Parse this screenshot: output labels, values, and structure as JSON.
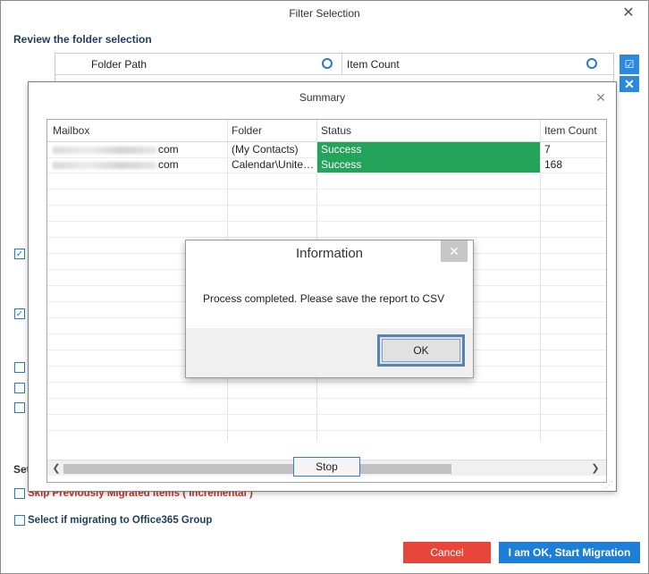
{
  "main_window": {
    "title": "Filter Selection",
    "close_glyph": "✕",
    "review_label": "Review the folder selection",
    "folder_grid": {
      "col_folder_path": "Folder Path",
      "col_item_count": "Item Count"
    },
    "side_buttons": [
      "check-icon",
      "close-icon"
    ],
    "settings_label": "Set",
    "skip_label": "Skip Previously Migrated Items ( Incremental )",
    "o365_label": "Select if migrating to Office365 Group",
    "cancel_label": "Cancel",
    "start_label": "I am OK, Start Migration"
  },
  "summary": {
    "title": "Summary",
    "close_glyph": "✕",
    "columns": [
      "Mailbox",
      "Folder",
      "Status",
      "Item Count"
    ],
    "rows": [
      {
        "mailbox_suffix": "com",
        "folder": "(My Contacts)",
        "status": "Success",
        "item_count": "7"
      },
      {
        "mailbox_suffix": "com",
        "folder": "Calendar\\Unite…",
        "status": "Success",
        "item_count": "168"
      }
    ],
    "stop_label": "Stop",
    "colors": {
      "success": "#24a35a"
    }
  },
  "info_dialog": {
    "title": "Information",
    "close_glyph": "✕",
    "message": "Process completed. Please save the report to CSV",
    "ok_label": "OK"
  }
}
